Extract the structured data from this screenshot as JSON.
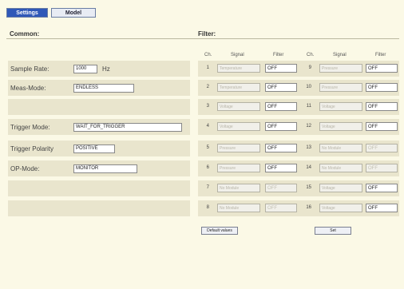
{
  "tabs": {
    "settings": "Settings",
    "model": "Model"
  },
  "common": {
    "title": "Common:",
    "sample_rate": {
      "label": "Sample Rate:",
      "value": "1000",
      "unit": "Hz"
    },
    "meas_mode": {
      "label": "Meas-Mode:",
      "value": "ENDLESS"
    },
    "trigger_mode": {
      "label": "Trigger Mode:",
      "value": "WAIT_FOR_TRIGGER"
    },
    "trigger_polarity": {
      "label": "Trigger Polarity",
      "value": "POSITIVE"
    },
    "op_mode": {
      "label": "OP-Mode:",
      "value": "MONITOR"
    }
  },
  "filter": {
    "title": "Filter:",
    "headers": {
      "ch": "Ch.",
      "signal": "Signal",
      "filter": "Filter"
    },
    "rows": [
      {
        "ch1": "1",
        "sig1": "Temperature",
        "flt1": "OFF",
        "flt1_enabled": true,
        "ch2": "9",
        "sig2": "Pressure",
        "flt2": "OFF",
        "flt2_enabled": true
      },
      {
        "ch1": "2",
        "sig1": "Temperature",
        "flt1": "OFF",
        "flt1_enabled": true,
        "ch2": "10",
        "sig2": "Pressure",
        "flt2": "OFF",
        "flt2_enabled": true
      },
      {
        "ch1": "3",
        "sig1": "Voltage",
        "flt1": "OFF",
        "flt1_enabled": true,
        "ch2": "11",
        "sig2": "Voltage",
        "flt2": "OFF",
        "flt2_enabled": true
      },
      {
        "ch1": "4",
        "sig1": "Voltage",
        "flt1": "OFF",
        "flt1_enabled": true,
        "ch2": "12",
        "sig2": "Voltage",
        "flt2": "OFF",
        "flt2_enabled": true
      },
      {
        "ch1": "5",
        "sig1": "Pressure",
        "flt1": "OFF",
        "flt1_enabled": true,
        "ch2": "13",
        "sig2": "No Module",
        "flt2": "OFF",
        "flt2_enabled": false
      },
      {
        "ch1": "6",
        "sig1": "Pressure",
        "flt1": "OFF",
        "flt1_enabled": true,
        "ch2": "14",
        "sig2": "No Module",
        "flt2": "OFF",
        "flt2_enabled": false
      },
      {
        "ch1": "7",
        "sig1": "No Module",
        "flt1": "OFF",
        "flt1_enabled": false,
        "ch2": "15",
        "sig2": "Voltage",
        "flt2": "OFF",
        "flt2_enabled": true
      },
      {
        "ch1": "8",
        "sig1": "No Module",
        "flt1": "OFF",
        "flt1_enabled": false,
        "ch2": "16",
        "sig2": "Voltage",
        "flt2": "OFF",
        "flt2_enabled": true
      }
    ]
  },
  "buttons": {
    "default_values": "Default values",
    "set": "Set"
  },
  "colors": {
    "background": "#fbf9e6",
    "band": "#e9e5cd",
    "active_tab": "#2f58b8"
  }
}
